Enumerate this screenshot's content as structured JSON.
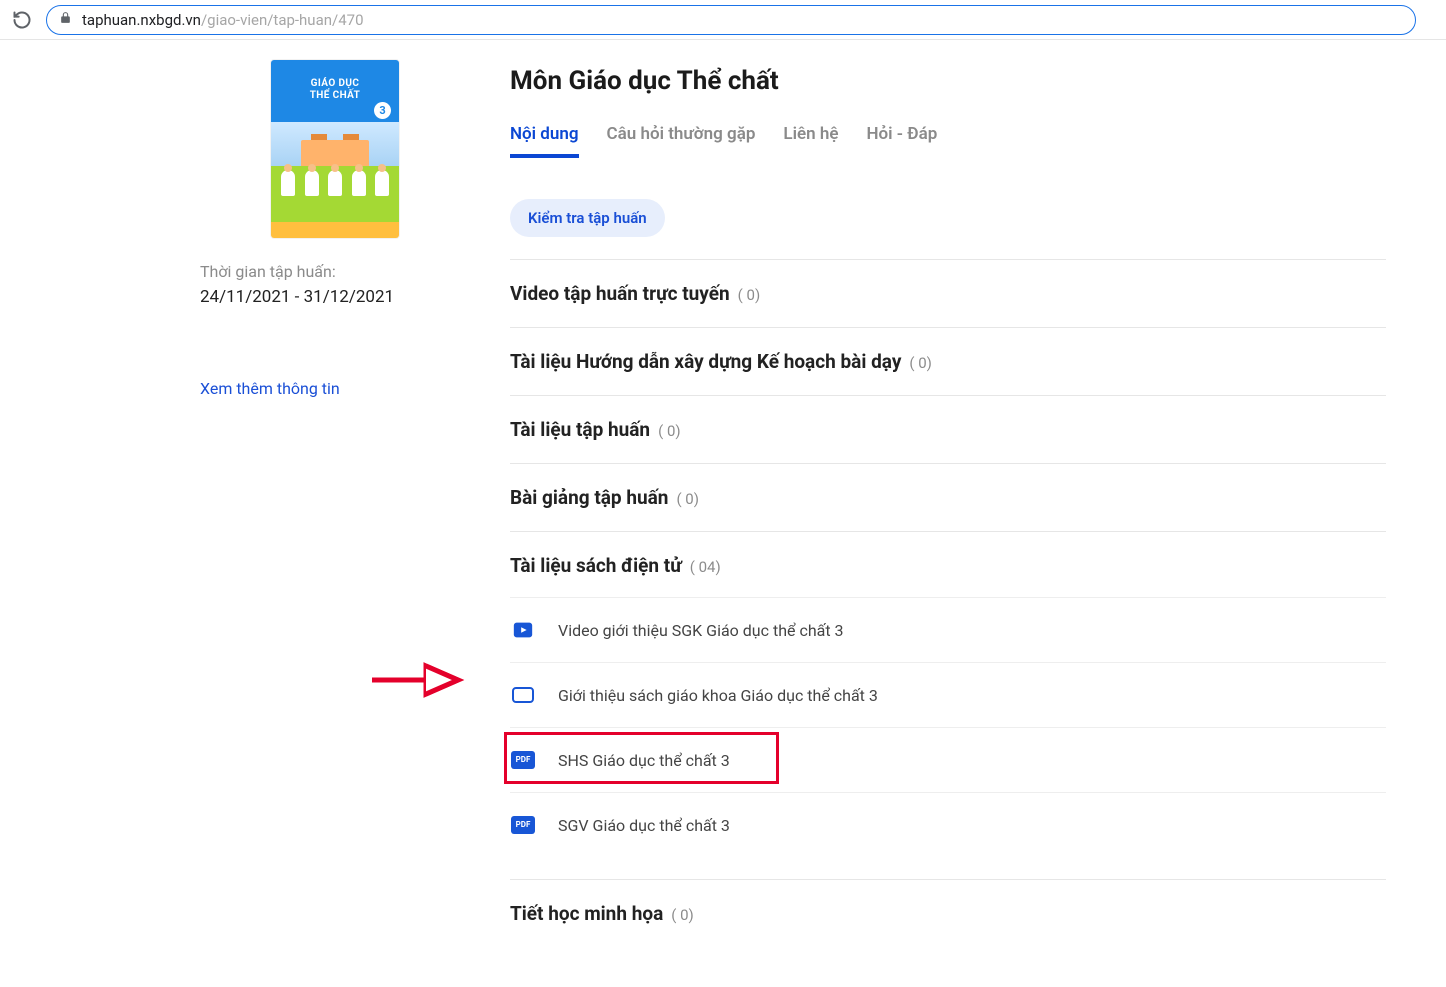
{
  "browser": {
    "url_host": "taphuan.nxbgd.vn",
    "url_path": "/giao-vien/tap-huan/470"
  },
  "cover": {
    "line1": "GIÁO DỤC",
    "line2": "THỂ CHẤT",
    "grade": "3"
  },
  "sidebar": {
    "time_label": "Thời gian tập huấn:",
    "time_value": "24/11/2021 - 31/12/2021",
    "more_link": "Xem thêm thông tin"
  },
  "main": {
    "title": "Môn Giáo dục Thể chất",
    "tabs": {
      "content": "Nội dung",
      "faq": "Câu hỏi thường gặp",
      "contact": "Liên hệ",
      "qa": "Hỏi - Đáp"
    },
    "check_btn": "Kiểm tra tập huấn",
    "sections": {
      "s1": {
        "title": "Video tập huấn trực tuyến",
        "count": "( 0)"
      },
      "s2": {
        "title": "Tài liệu Hướng dẫn xây dựng Kế hoạch bài dạy",
        "count": "( 0)"
      },
      "s3": {
        "title": "Tài liệu tập huấn",
        "count": "( 0)"
      },
      "s4": {
        "title": "Bài giảng tập huấn",
        "count": "( 0)"
      },
      "s5": {
        "title": "Tài liệu sách điện tử",
        "count": "( 04)",
        "items": {
          "i1": "Video giới thiệu SGK Giáo dục thể chất 3",
          "i2": "Giới thiệu sách giáo khoa Giáo dục thể chất 3",
          "i3": "SHS Giáo dục thể chất 3",
          "i4": "SGV Giáo dục thể chất 3"
        }
      },
      "s6": {
        "title": "Tiết học minh họa",
        "count": "( 0)"
      }
    }
  },
  "icon_labels": {
    "pdf": "PDF"
  }
}
